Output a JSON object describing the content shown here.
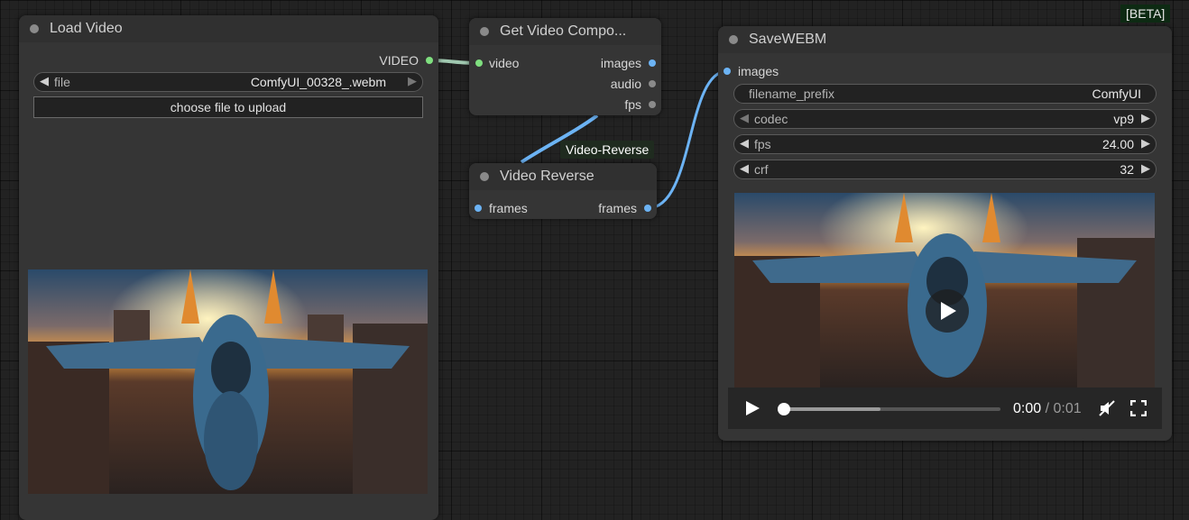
{
  "load_video": {
    "title": "Load Video",
    "output_label": "VIDEO",
    "file_widget": {
      "label": "file",
      "value": "ComfyUI_00328_.webm"
    },
    "upload_button": "choose file to upload"
  },
  "get_components": {
    "title": "Get Video Compo...",
    "input_label": "video",
    "outputs": [
      "images",
      "audio",
      "fps"
    ]
  },
  "group_label": "Video-Reverse",
  "video_reverse": {
    "title": "Video Reverse",
    "input_label": "frames",
    "output_label": "frames"
  },
  "save_webm": {
    "badge": "[BETA]",
    "title": "SaveWEBM",
    "input_label": "images",
    "widgets": [
      {
        "label": "filename_prefix",
        "value": "ComfyUI"
      },
      {
        "label": "codec",
        "value": "vp9"
      },
      {
        "label": "fps",
        "value": "24.00"
      },
      {
        "label": "crf",
        "value": "32"
      }
    ],
    "player": {
      "current_time": "0:00",
      "separator": " / ",
      "duration": "0:01",
      "buffered": 0.45
    }
  },
  "colors": {
    "canvas": "#222222",
    "node_body": "#353535",
    "node_title": "#303030",
    "link_image": "#6cb3f4",
    "link_video": "#a0c8b0",
    "slot_video": "#7fdf7f"
  },
  "icons": [
    "play-icon",
    "mute-icon",
    "fullscreen-icon",
    "left-arrow-icon",
    "right-arrow-icon"
  ]
}
